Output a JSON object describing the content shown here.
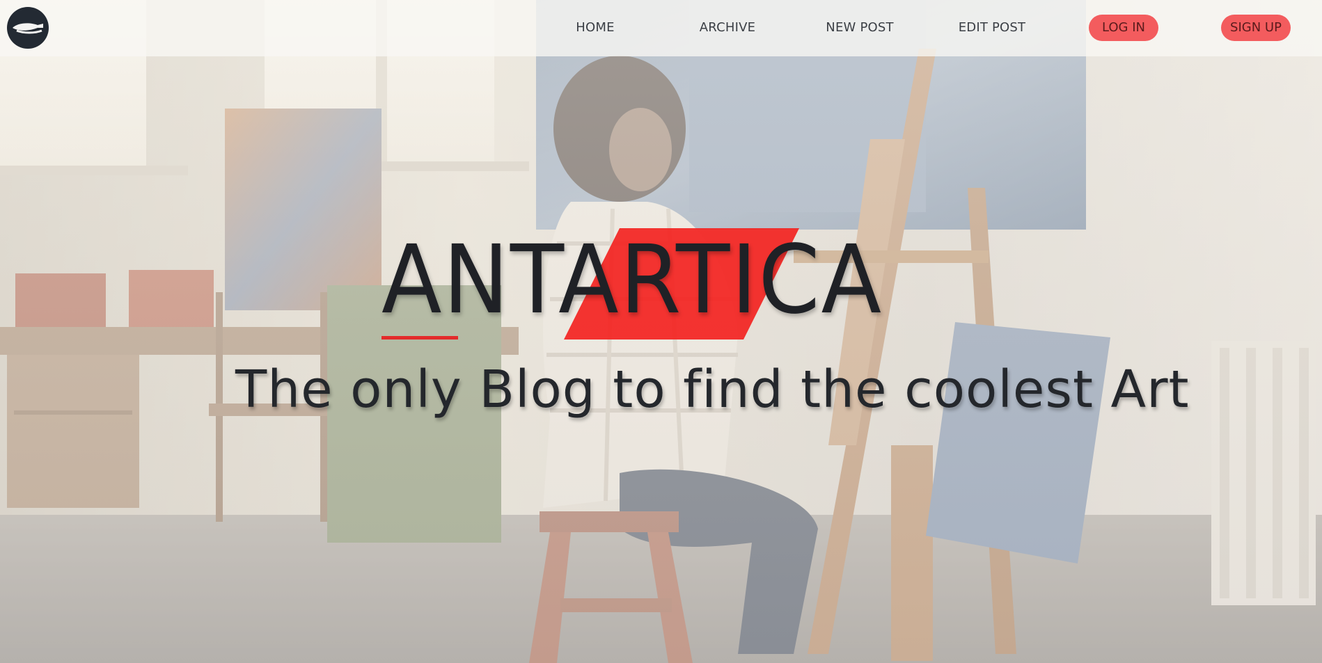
{
  "nav": {
    "links": [
      {
        "label": "HOME"
      },
      {
        "label": "ARCHIVE"
      },
      {
        "label": "NEW POST"
      },
      {
        "label": "EDIT POST"
      }
    ],
    "login_label": "LOG IN",
    "signup_label": "SIGN UP"
  },
  "hero": {
    "title": "ANTARTICA",
    "tagline": "The only Blog to find the coolest Art"
  },
  "colors": {
    "accent": "#f35c5e",
    "highlight": "#f32321",
    "text_dark": "#1f2126"
  },
  "icons": {
    "logo": "brush-logo-icon"
  }
}
